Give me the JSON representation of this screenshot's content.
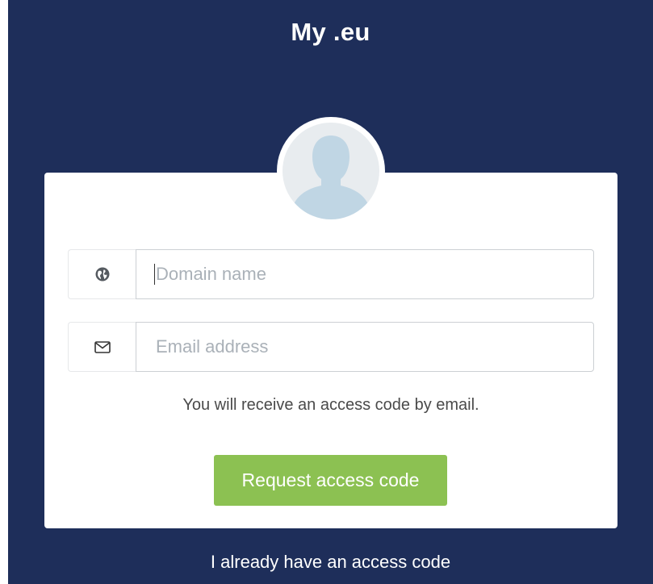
{
  "header": {
    "title": "My .eu"
  },
  "avatar": {
    "icon": "user-silhouette-icon"
  },
  "form": {
    "domain_field": {
      "icon": "globe-icon",
      "placeholder": "Domain name",
      "value": ""
    },
    "email_field": {
      "icon": "envelope-icon",
      "placeholder": "Email address",
      "value": ""
    },
    "hint": "You will receive an access code by email.",
    "submit_label": "Request access code"
  },
  "footer": {
    "have_code_link": "I already have an access code"
  },
  "colors": {
    "background": "#1e2e5a",
    "card": "#ffffff",
    "button": "#8cc152",
    "avatar_bg": "#e8ecef",
    "avatar_figure": "#c0d6e4"
  }
}
